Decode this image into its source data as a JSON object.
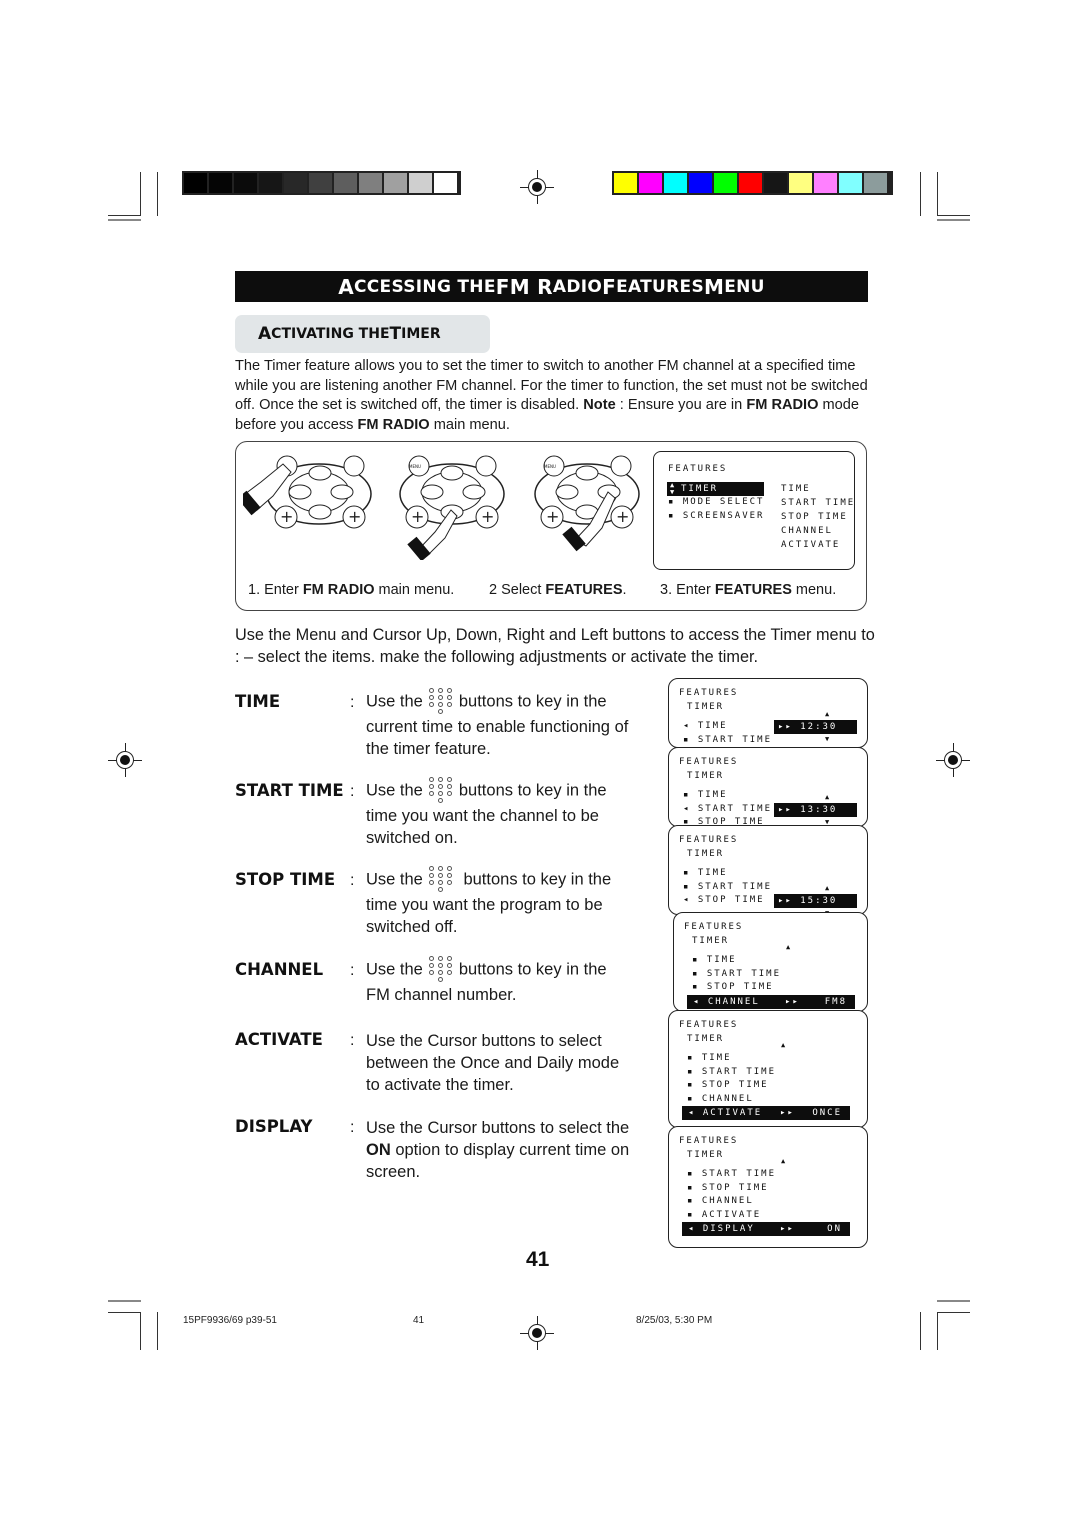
{
  "color_bars": {
    "grayscale": [
      "#000000",
      "#050505",
      "#0b0b0b",
      "#161616",
      "#282828",
      "#404040",
      "#5e5e5e",
      "#7f7f7f",
      "#a0a0a0",
      "#cfcfcf",
      "#ffffff"
    ],
    "colors": [
      "#ffff00",
      "#ff00ff",
      "#00ffff",
      "#0000ff",
      "#00ff00",
      "#ff0000",
      "#161616",
      "#ffff80",
      "#ff80ff",
      "#80ffff",
      "#8c9c9c"
    ]
  },
  "section_title": {
    "a1": "A",
    "a2": "CCESSING THE ",
    "a3": "FM R",
    "a4": "ADIO ",
    "a5": "F",
    "a6": "EATURES ",
    "a7": "M",
    "a8": "ENU"
  },
  "subsection_title": {
    "a1": "A",
    "a2": "CTIVATING THE ",
    "a3": "T",
    "a4": "IMER"
  },
  "intro": {
    "p1": "The Timer feature allows you to set the timer to switch to another FM channel at a specified time while you are listening another FM channel.  For the timer to function, the set must not be switched off. Once the set is switched off, the timer is disabled. ",
    "note_label": "Note",
    "p2": " :  Ensure you are in ",
    "fm1": "FM RADIO",
    "p3": " mode before you access ",
    "fm2": "FM RADIO",
    "p4": " main menu."
  },
  "steps": [
    {
      "pre": "1. Enter ",
      "bold": "FM RADIO",
      "post": " main menu."
    },
    {
      "pre": "2  Select ",
      "bold": "FEATURES",
      "post": "."
    },
    {
      "pre": "3.  Enter ",
      "bold": "FEATURES",
      "post": " menu."
    }
  ],
  "remote": {
    "menu_label": "MENU"
  },
  "features_menu": {
    "title": "FEATURES",
    "items": [
      "TIMER",
      "MODE SELECT",
      "SCREENSAVER"
    ],
    "selected": "TIMER",
    "submenu": [
      "TIME",
      "START TIME",
      "STOP TIME",
      "CHANNEL",
      "ACTIVATE"
    ]
  },
  "usage_text": "Use the Menu and Cursor Up, Down, Right and Left buttons to access the Timer menu to : –    select the items. make the following adjustments or activate the timer.",
  "items": [
    {
      "label": "TIME",
      "pre": "Use the",
      "post": "buttons to key in the",
      "rest": "current time to enable functioning of the timer feature."
    },
    {
      "label": "START TIME",
      "pre": "Use the",
      "post": "buttons to key in the",
      "rest": "time you want the channel to be switched on."
    },
    {
      "label": "STOP  TIME",
      "pre": "Use the",
      "post": " buttons to key in the",
      "rest": "time you want the program to be switched off."
    },
    {
      "label": "CHANNEL",
      "pre": "Use the",
      "post": "buttons to key in the",
      "rest": "FM channel number."
    },
    {
      "label": "ACTIVATE",
      "text": "Use the Cursor buttons to select between the Once and Daily mode to activate the timer."
    },
    {
      "label": "DISPLAY",
      "text_pre": "Use the Cursor buttons to select the ",
      "text_bold": "ON",
      "text_post": " option to display current time on screen."
    }
  ],
  "colon": ":",
  "osd_screens": [
    {
      "title": "FEATURES",
      "sub": "TIMER",
      "rows": [
        "TIME",
        "START TIME"
      ],
      "value": "12:30"
    },
    {
      "title": "FEATURES",
      "sub": "TIMER",
      "rows": [
        "TIME",
        "START TIME",
        "STOP TIME"
      ],
      "value": "13:30"
    },
    {
      "title": "FEATURES",
      "sub": "TIMER",
      "rows": [
        "TIME",
        "START TIME",
        "STOP TIME"
      ],
      "value": "15:30"
    },
    {
      "title": "FEATURES",
      "sub": "TIMER",
      "rows": [
        "TIME",
        "START TIME",
        "STOP TIME"
      ],
      "hl_label": "CHANNEL",
      "value": "FM8"
    },
    {
      "title": "FEATURES",
      "sub": "TIMER",
      "rows": [
        "TIME",
        "START TIME",
        "STOP TIME",
        "CHANNEL"
      ],
      "hl_label": "ACTIVATE",
      "value": "ONCE"
    },
    {
      "title": "FEATURES",
      "sub": "TIMER",
      "rows": [
        "START TIME",
        "STOP TIME",
        "CHANNEL",
        "ACTIVATE"
      ],
      "hl_label": "DISPLAY",
      "value": "ON"
    }
  ],
  "page_number": "41",
  "footer": {
    "file": "15PF9936/69 p39-51",
    "page": "41",
    "timestamp": "8/25/03, 5:30 PM"
  }
}
